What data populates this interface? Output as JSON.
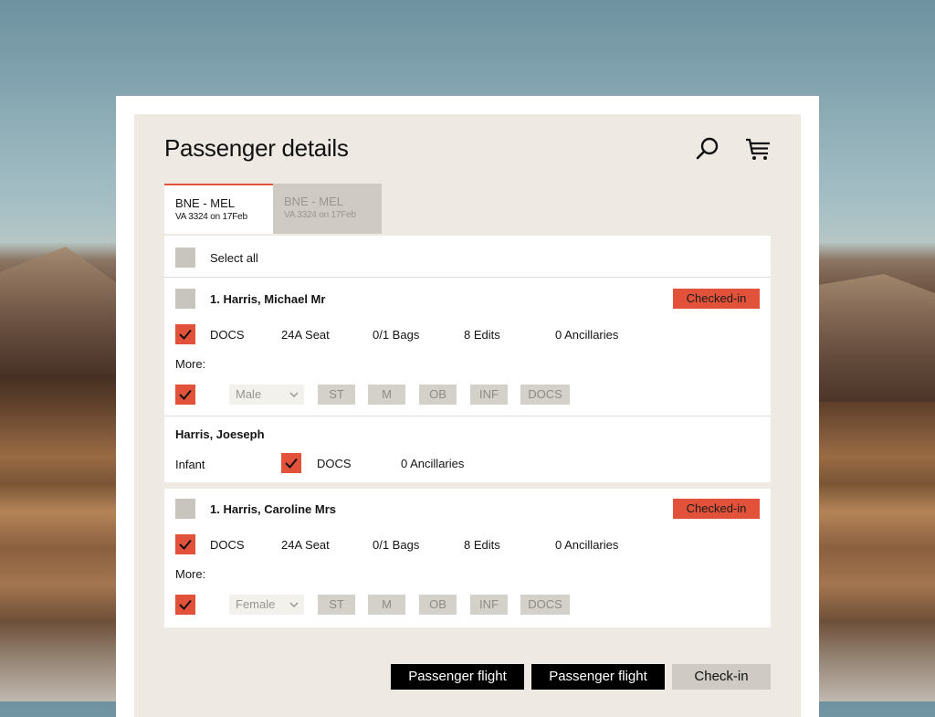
{
  "page": {
    "title": "Passenger details"
  },
  "icons": {
    "search": "search-icon",
    "cart": "cart-icon"
  },
  "tabs": [
    {
      "route": "BNE - MEL",
      "flight": "VA 3324 on 17Feb",
      "active": true
    },
    {
      "route": "BNE - MEL",
      "flight": "VA 3324 on 17Feb",
      "active": false
    }
  ],
  "select_all": {
    "label": "Select all"
  },
  "passengers": [
    {
      "name": "1. Harris, Michael Mr",
      "status": "Checked-in",
      "docs": "DOCS",
      "seat": "24A Seat",
      "bags": "0/1 Bags",
      "edits": "8 Edits",
      "ancillaries": "0 Ancillaries",
      "more_label": "More:",
      "gender": "Male",
      "options": [
        "ST",
        "M",
        "OB",
        "INF",
        "DOCS"
      ]
    },
    {
      "name": "1. Harris, Caroline Mrs",
      "status": "Checked-in",
      "docs": "DOCS",
      "seat": "24A Seat",
      "bags": "0/1 Bags",
      "edits": "8 Edits",
      "ancillaries": "0 Ancillaries",
      "more_label": "More:",
      "gender": "Female",
      "options": [
        "ST",
        "M",
        "OB",
        "INF",
        "DOCS"
      ]
    }
  ],
  "infant": {
    "name": "Harris, Joeseph",
    "type": "Infant",
    "docs": "DOCS",
    "ancillaries": "0 Ancillaries"
  },
  "footer": {
    "button1": "Passenger flight",
    "button2": "Passenger flight",
    "button3": "Check-in"
  },
  "colors": {
    "accent": "#e2523a",
    "panel": "#eeeae3",
    "muted": "#c8c5bf"
  }
}
